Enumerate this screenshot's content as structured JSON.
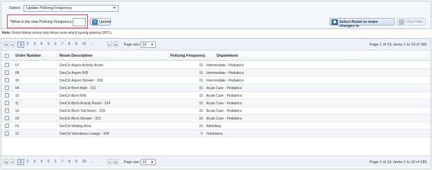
{
  "controls": {
    "select_label": "Select:",
    "select_value": "Update Policing Frequency",
    "freq_label": "*What is the new Policing Frequency:",
    "update_label": "Update",
    "room_button_label": "Select Room to make changes to",
    "view_filter_label": "View Filter"
  },
  "note": {
    "prefix": "Note:",
    "text": " Room listing shows only those room which having policing SPC's"
  },
  "pager": {
    "pages": [
      "1",
      "2",
      "3",
      "4",
      "5",
      "6",
      "7",
      "8",
      "9",
      "10",
      "..."
    ],
    "current": "1",
    "page_size_label": "Page size:",
    "page_size": "10",
    "info": "Page 1 of 19, items 1 to 10 of 182."
  },
  "columns": {
    "order": "Order Number",
    "room": "Room Description",
    "freq": "Policing Frequency",
    "dept": "Department"
  },
  "rows": [
    {
      "order": "07",
      "room": "DenCtr:Aspen Activity Room",
      "freq": "15",
      "dept": "Intermediate - Pediatrics"
    },
    {
      "order": "08",
      "room": "DenCtr:Aspen R/R",
      "freq": "15",
      "dept": "Intermediate - Pediatrics"
    },
    {
      "order": "16",
      "room": "DenCtr:Aspen Shower - 106",
      "freq": "15",
      "dept": "Intermediate - Pediatrics"
    },
    {
      "order": "04",
      "room": "DenCtr:Birch Bath - 211",
      "freq": "15",
      "dept": "Acute Care - Pediatrics"
    },
    {
      "order": "10",
      "room": "DenCtr:Birch R/R",
      "freq": "15",
      "dept": "Acute Care - Pediatrics"
    },
    {
      "order": "11",
      "room": "DenCtr:Birch Activity Room - 224",
      "freq": "15",
      "dept": "Acute Care - Pediatrics"
    },
    {
      "order": "19",
      "room": "DenCtr:Birch Tub Room - 218",
      "freq": "15",
      "dept": "Acute Care - Pediatrics"
    },
    {
      "order": "20",
      "room": "DenCtr:Birch Shower - 202",
      "freq": "15",
      "dept": "Acute Care - Pediatrics"
    },
    {
      "order": "01",
      "room": "DenCtr:Waiting Area",
      "freq": "15",
      "dept": "Admitting"
    },
    {
      "order": "12",
      "room": "DenCtr:Volunteers Lounge - 504",
      "freq": "5",
      "dept": "Volunteers"
    }
  ]
}
